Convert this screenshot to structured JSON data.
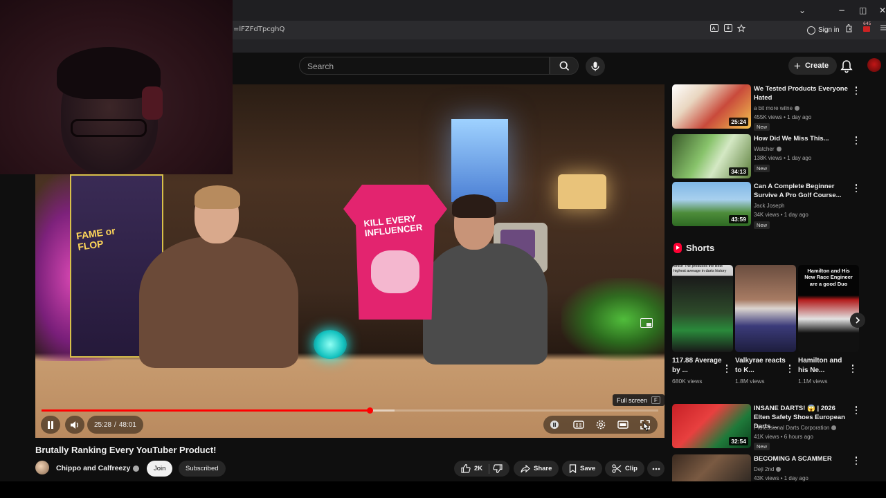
{
  "browser": {
    "url": "=lFZFdTpcghQ",
    "signin_label": "Sign in",
    "extension_badge": "645",
    "window_controls": {
      "chevron": "⌄",
      "minimize": "−",
      "maximize": "◫",
      "close": "✕"
    }
  },
  "masthead": {
    "search_placeholder": "Search",
    "create_label": "Create"
  },
  "player": {
    "progress": {
      "played_fraction": 0.532,
      "loaded_fraction": 0.572
    },
    "current_time": "25:28",
    "separator": "/",
    "duration": "48:01",
    "tooltip_label": "Full screen",
    "tooltip_key": "F",
    "scene": {
      "board_text": "FAME or FLOP",
      "shirt_text": "KILL EVERY INFLUENCER"
    }
  },
  "video": {
    "title": "Brutally Ranking Every YouTuber Product!",
    "channel": "Chippo and Calfreezy",
    "join_label": "Join",
    "subscribed_label": "Subscribed",
    "like_count": "2K",
    "share_label": "Share",
    "save_label": "Save",
    "clip_label": "Clip"
  },
  "sidebar": {
    "recommendations": [
      {
        "title": "We Tested Products Everyone Hated",
        "channel": "a bit more wilne",
        "views": "455K views",
        "age": "1 day ago",
        "duration": "25:24",
        "badge": "New",
        "verified": true
      },
      {
        "title": "How Did We Miss This...",
        "channel": "Watcher",
        "views": "138K views",
        "age": "1 day ago",
        "duration": "34:13",
        "badge": "New",
        "verified": true
      },
      {
        "title": "Can A Complete Beginner Survive A Pro Golf Course...",
        "channel": "Jack Joseph",
        "views": "34K views",
        "age": "1 day ago",
        "duration": "43:59",
        "badge": "New",
        "verified": false
      },
      {
        "title": "INSANE DARTS! 😱 | 2026 Elten Safety Shoes European Darts ...",
        "channel": "Professional Darts Corporation",
        "views": "41K views",
        "age": "6 hours ago",
        "duration": "32:54",
        "badge": "New",
        "verified": true
      },
      {
        "title": "BECOMING A SCAMMER",
        "channel": "Deji 2nd",
        "views": "43K views",
        "age": "1 day ago",
        "duration": "",
        "badge": "",
        "verified": true
      }
    ],
    "shorts_heading": "Shorts",
    "shorts": [
      {
        "title": "117.88 Average by ...",
        "views": "680K views",
        "caption": "which The produces the Best highest average in darts history"
      },
      {
        "title": "Valkyrae reacts to K...",
        "views": "1.8M views",
        "caption": ""
      },
      {
        "title": "Hamilton and his Ne...",
        "views": "1.1M views",
        "caption": "Hamilton and His New Race Engineer are a good Duo"
      }
    ]
  }
}
